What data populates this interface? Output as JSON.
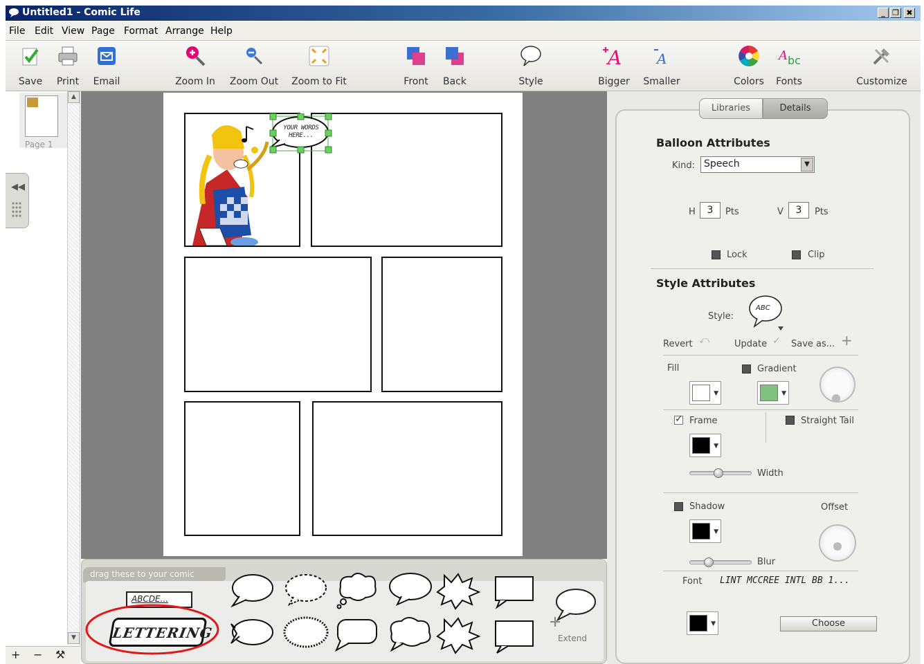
{
  "window": {
    "title": "Untitled1 - Comic Life",
    "minimize": "_",
    "maximize": "❐",
    "close": "✖"
  },
  "menu": [
    "File",
    "Edit",
    "View",
    "Page",
    "Format",
    "Arrange",
    "Help"
  ],
  "toolbar": {
    "save": "Save",
    "print": "Print",
    "email": "Email",
    "zoom_in": "Zoom In",
    "zoom_out": "Zoom Out",
    "zoom_fit": "Zoom to Fit",
    "front": "Front",
    "back": "Back",
    "style": "Style",
    "bigger": "Bigger",
    "smaller": "Smaller",
    "colors": "Colors",
    "fonts": "Fonts",
    "customize": "Customize"
  },
  "pages": {
    "page1_label": "Page 1"
  },
  "canvas": {
    "balloon_text": "YOUR WORDS HERE..."
  },
  "drag_strip": {
    "title": "drag these to your comic",
    "textbox_sample": "ABCDE...",
    "lettering_sample": "LETTERING",
    "extend_label": "Extend"
  },
  "inspector": {
    "tabs": {
      "libraries": "Libraries",
      "details": "Details"
    },
    "balloon": {
      "heading": "Balloon Attributes",
      "kind_label": "Kind:",
      "kind_value": "Speech",
      "h_label": "H",
      "h_value": "3",
      "h_unit": "Pts",
      "v_label": "V",
      "v_value": "3",
      "v_unit": "Pts",
      "lock": "Lock",
      "clip": "Clip"
    },
    "style": {
      "heading": "Style Attributes",
      "style_label": "Style:",
      "style_preview": "ABC",
      "revert": "Revert",
      "update": "Update",
      "save_as": "Save as...",
      "fill": "Fill",
      "gradient": "Gradient",
      "frame": "Frame",
      "straight_tail": "Straight Tail",
      "width": "Width",
      "shadow": "Shadow",
      "offset": "Offset",
      "blur": "Blur",
      "font_label": "Font",
      "font_value": "LINT MCCREE INTL BB 1...",
      "choose": "Choose"
    },
    "colors": {
      "fill": "#ffffff",
      "gradient": "#7dc27d",
      "frame": "#000000",
      "shadow": "#000000",
      "text": "#000000"
    }
  },
  "bottom_controls": {
    "add": "+",
    "remove": "−",
    "tools": "⚒"
  }
}
